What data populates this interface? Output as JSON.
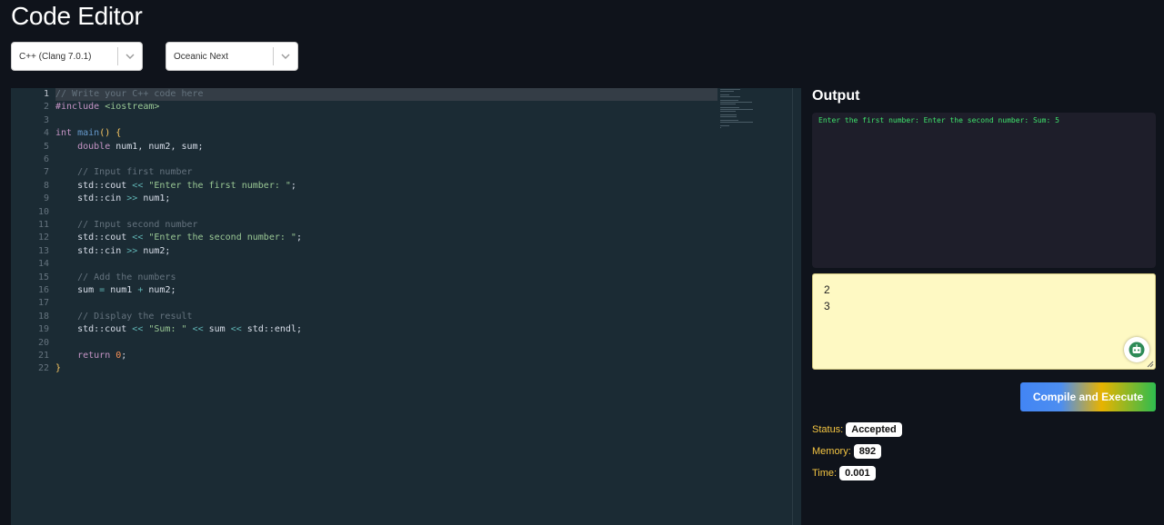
{
  "app": {
    "title": "Code Editor"
  },
  "language_select": {
    "value": "C++ (Clang 7.0.1)"
  },
  "theme_select": {
    "value": "Oceanic Next"
  },
  "editor": {
    "line_numbers": [
      "1",
      "2",
      "3",
      "4",
      "5",
      "6",
      "7",
      "8",
      "9",
      "10",
      "11",
      "12",
      "13",
      "14",
      "15",
      "16",
      "17",
      "18",
      "19",
      "20",
      "21",
      "22"
    ],
    "lines": [
      [
        [
          "com",
          "// Write your C++ code here"
        ]
      ],
      [
        [
          "kw",
          "#include"
        ],
        [
          "def",
          " "
        ],
        [
          "str",
          "<iostream>"
        ]
      ],
      [],
      [
        [
          "kw",
          "int"
        ],
        [
          "def",
          " "
        ],
        [
          "fn",
          "main"
        ],
        [
          "br",
          "() {"
        ]
      ],
      [
        [
          "def",
          "    "
        ],
        [
          "kw",
          "double"
        ],
        [
          "def",
          " num1, num2, sum;"
        ]
      ],
      [],
      [
        [
          "def",
          "    "
        ],
        [
          "com",
          "// Input first number"
        ]
      ],
      [
        [
          "def",
          "    std::cout "
        ],
        [
          "op",
          "<<"
        ],
        [
          "def",
          " "
        ],
        [
          "str",
          "\"Enter the first number: \""
        ],
        [
          "def",
          ";"
        ]
      ],
      [
        [
          "def",
          "    std::cin "
        ],
        [
          "op",
          ">>"
        ],
        [
          "def",
          " num1;"
        ]
      ],
      [],
      [
        [
          "def",
          "    "
        ],
        [
          "com",
          "// Input second number"
        ]
      ],
      [
        [
          "def",
          "    std::cout "
        ],
        [
          "op",
          "<<"
        ],
        [
          "def",
          " "
        ],
        [
          "str",
          "\"Enter the second number: \""
        ],
        [
          "def",
          ";"
        ]
      ],
      [
        [
          "def",
          "    std::cin "
        ],
        [
          "op",
          ">>"
        ],
        [
          "def",
          " num2;"
        ]
      ],
      [],
      [
        [
          "def",
          "    "
        ],
        [
          "com",
          "// Add the numbers"
        ]
      ],
      [
        [
          "def",
          "    sum "
        ],
        [
          "op",
          "="
        ],
        [
          "def",
          " num1 "
        ],
        [
          "op",
          "+"
        ],
        [
          "def",
          " num2;"
        ]
      ],
      [],
      [
        [
          "def",
          "    "
        ],
        [
          "com",
          "// Display the result"
        ]
      ],
      [
        [
          "def",
          "    std::cout "
        ],
        [
          "op",
          "<<"
        ],
        [
          "def",
          " "
        ],
        [
          "str",
          "\"Sum: \""
        ],
        [
          "def",
          " "
        ],
        [
          "op",
          "<<"
        ],
        [
          "def",
          " sum "
        ],
        [
          "op",
          "<<"
        ],
        [
          "def",
          " std::endl;"
        ]
      ],
      [],
      [
        [
          "def",
          "    "
        ],
        [
          "kw",
          "return"
        ],
        [
          "def",
          " "
        ],
        [
          "num",
          "0"
        ],
        [
          "def",
          ";"
        ]
      ],
      [
        [
          "br",
          "}"
        ]
      ]
    ]
  },
  "output": {
    "title": "Output",
    "text": "Enter the first number: Enter the second number: Sum: 5"
  },
  "stdin": {
    "lines": [
      "2",
      "3"
    ]
  },
  "run_button": {
    "label": "Compile and Execute"
  },
  "stats": {
    "status_label": "Status:",
    "status_value": "Accepted",
    "memory_label": "Memory:",
    "memory_value": "892",
    "time_label": "Time:",
    "time_value": "0.001"
  },
  "colors": {
    "background": "#0f131b",
    "editor_bg": "#1b2b34",
    "stdin_bg": "#fef9c3",
    "output_text": "#3fe36c",
    "stat_label": "#f4c542"
  },
  "icons": {
    "select_arrow": "chevron-down-icon",
    "assistant": "robot-icon",
    "resize": "resize-handle-icon"
  }
}
